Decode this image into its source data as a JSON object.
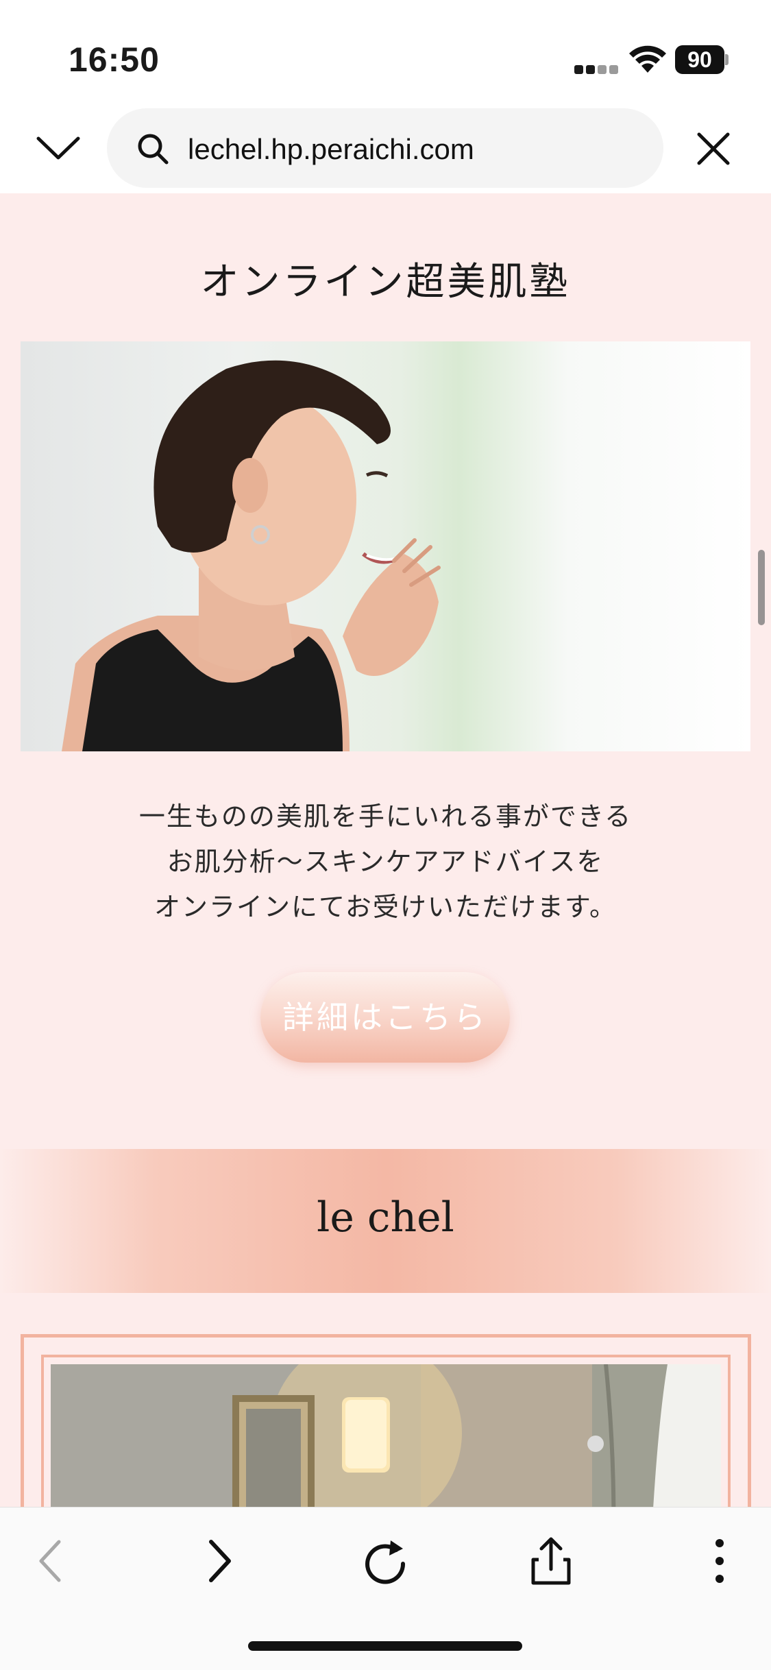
{
  "status_bar": {
    "time": "16:50",
    "battery": "90",
    "icons": [
      "cellular-signal-icon",
      "wifi-icon",
      "battery-icon"
    ]
  },
  "browser": {
    "url": "lechel.hp.peraichi.com",
    "icons": [
      "chevron-down-icon",
      "search-icon",
      "close-icon"
    ]
  },
  "page": {
    "section_title": "オンライン超美肌塾",
    "description_lines": [
      "一生ものの美肌を手にいれる事ができる",
      "お肌分析〜スキンケアアドバイスを",
      "オンラインにてお受けいただけます。"
    ],
    "detail_button": "詳細はこちら",
    "band_title": "le chel"
  },
  "toolbar": {
    "items": [
      {
        "name": "back",
        "icon": "chevron-left-icon",
        "enabled": false
      },
      {
        "name": "forward",
        "icon": "chevron-right-icon",
        "enabled": true
      },
      {
        "name": "reload",
        "icon": "reload-icon",
        "enabled": true
      },
      {
        "name": "share",
        "icon": "share-icon",
        "enabled": true
      },
      {
        "name": "more",
        "icon": "more-vertical-icon",
        "enabled": true
      }
    ]
  },
  "colors": {
    "page_background": "#fdeceb",
    "accent": "#f2b39f",
    "button_text": "#ffffff"
  }
}
